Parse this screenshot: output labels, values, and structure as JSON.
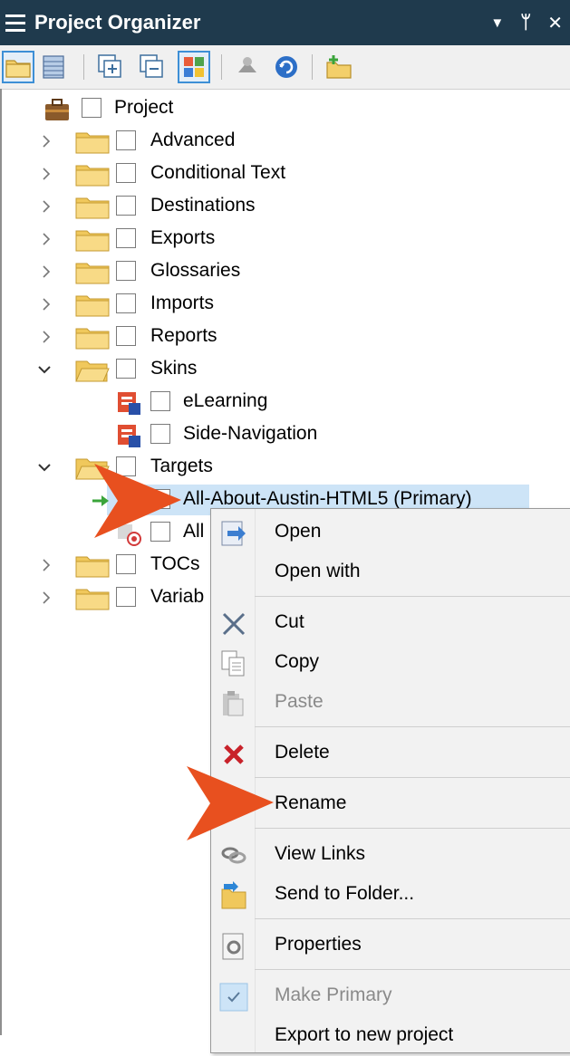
{
  "titlebar": {
    "title": "Project Organizer",
    "dropdown_glyph": "▼",
    "pin_glyph": "ᛘ",
    "close_glyph": "✕"
  },
  "toolbar": {
    "buttons": [
      "folder-icon",
      "grid-view-icon",
      "expand-all-icon",
      "collapse-all-icon",
      "color-palette-icon",
      "bind-icon",
      "refresh-icon",
      "new-folder-icon"
    ]
  },
  "tree": {
    "root": {
      "label": "Project",
      "icon": "briefcase-icon"
    },
    "items": [
      {
        "label": "Advanced",
        "icon": "folder-icon",
        "expanded": false
      },
      {
        "label": "Conditional Text",
        "icon": "folder-icon",
        "expanded": false
      },
      {
        "label": "Destinations",
        "icon": "folder-icon",
        "expanded": false
      },
      {
        "label": "Exports",
        "icon": "folder-icon",
        "expanded": false
      },
      {
        "label": "Glossaries",
        "icon": "folder-icon",
        "expanded": false
      },
      {
        "label": "Imports",
        "icon": "folder-icon",
        "expanded": false
      },
      {
        "label": "Reports",
        "icon": "folder-icon",
        "expanded": false
      },
      {
        "label": "Skins",
        "icon": "folder-open-icon",
        "expanded": true
      },
      {
        "label": "eLearning",
        "icon": "skin-html5-icon",
        "child": true
      },
      {
        "label": "Side-Navigation",
        "icon": "skin-html5-icon",
        "child": true
      },
      {
        "label": "Targets",
        "icon": "folder-open-icon",
        "expanded": true
      },
      {
        "label": "All-About-Austin-HTML5 (Primary)",
        "icon": "target-icon",
        "child": true,
        "selected": true
      },
      {
        "label": "All",
        "icon": "target-disabled-icon",
        "child": true
      },
      {
        "label": "TOCs",
        "icon": "folder-icon",
        "expanded": false
      },
      {
        "label": "Variab",
        "icon": "folder-icon",
        "expanded": false
      }
    ]
  },
  "context_menu": {
    "items": [
      {
        "label": "Open",
        "icon": "open-icon",
        "disabled": false
      },
      {
        "label": "Open with",
        "icon": "",
        "disabled": false
      },
      {
        "label": "Cut",
        "icon": "scissors-icon",
        "disabled": false
      },
      {
        "label": "Copy",
        "icon": "copy-icon",
        "disabled": false
      },
      {
        "label": "Paste",
        "icon": "paste-icon",
        "disabled": true
      },
      {
        "label": "Delete",
        "icon": "delete-icon",
        "disabled": false
      },
      {
        "label": "Rename",
        "icon": "",
        "disabled": false
      },
      {
        "label": "View Links",
        "icon": "links-icon",
        "disabled": false
      },
      {
        "label": "Send to Folder...",
        "icon": "send-to-folder-icon",
        "disabled": false
      },
      {
        "label": "Properties",
        "icon": "properties-icon",
        "disabled": false
      },
      {
        "label": "Make Primary",
        "icon": "checkmark-icon",
        "disabled": true
      },
      {
        "label": "Export to new project",
        "icon": "",
        "disabled": false
      }
    ]
  },
  "colors": {
    "titlebar_bg": "#1f3a4d",
    "selection_bg": "#cde4f7",
    "callout_arrow": "#e8501f",
    "folder_yellow": "#f5d77a"
  }
}
